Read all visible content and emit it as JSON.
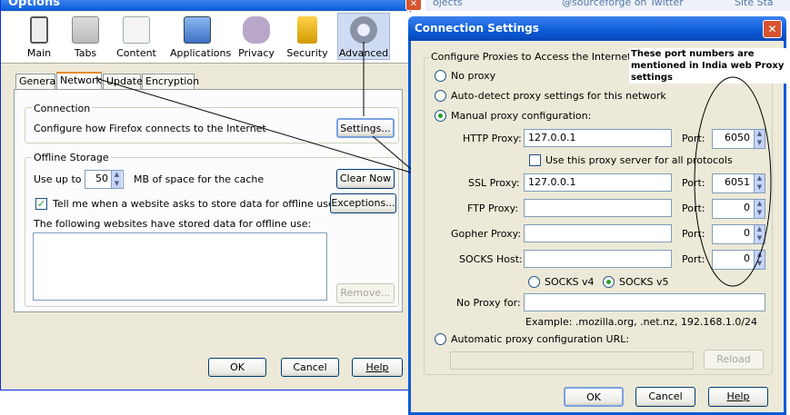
{
  "options": {
    "title": "Options",
    "toolbar": [
      {
        "label": "Main",
        "icon": "main-icon"
      },
      {
        "label": "Tabs",
        "icon": "tabs-icon"
      },
      {
        "label": "Content",
        "icon": "content-icon"
      },
      {
        "label": "Applications",
        "icon": "applications-icon"
      },
      {
        "label": "Privacy",
        "icon": "privacy-mask-icon"
      },
      {
        "label": "Security",
        "icon": "security-lock-icon"
      },
      {
        "label": "Advanced",
        "icon": "advanced-gear-icon"
      }
    ],
    "tabs": [
      "General",
      "Network",
      "Update",
      "Encryption"
    ],
    "connection": {
      "title": "Connection",
      "desc": "Configure how Firefox connects to the Internet",
      "settings_btn": "Settings..."
    },
    "offline": {
      "title": "Offline Storage",
      "use_up_to": "Use up to",
      "cache_value": "50",
      "cache_suffix": "MB of space for the cache",
      "clear_btn": "Clear Now",
      "tell_me": "Tell me when a website asks to store data for offline use",
      "exceptions_btn": "Exceptions...",
      "list_label": "The following websites have stored data for offline use:",
      "remove_btn": "Remove..."
    },
    "ok": "OK",
    "cancel": "Cancel",
    "help": "Help"
  },
  "browser_tabs": [
    "ojects",
    "@sourceforge on Twitter",
    "Site Sta"
  ],
  "conn": {
    "title": "Connection Settings",
    "group_title": "Configure Proxies to Access the Internet",
    "annotation": "These port numbers are mentioned in India web Proxy settings",
    "no_proxy": "No proxy",
    "auto_detect": "Auto-detect proxy settings for this network",
    "manual": "Manual proxy configuration:",
    "http_label": "HTTP Proxy:",
    "http_value": "127.0.0.1",
    "port_label": "Port:",
    "http_port": "6050",
    "same_proxy": "Use this proxy server for all protocols",
    "ssl_label": "SSL Proxy:",
    "ssl_value": "127.0.0.1",
    "ssl_port": "6051",
    "ftp_label": "FTP Proxy:",
    "ftp_port": "0",
    "gopher_label": "Gopher Proxy:",
    "gopher_port": "0",
    "socks_label": "SOCKS Host:",
    "socks_port": "0",
    "socks4": "SOCKS v4",
    "socks5": "SOCKS v5",
    "no_proxy_for": "No Proxy for:",
    "example": "Example: .mozilla.org, .net.nz, 192.168.1.0/24",
    "auto_url": "Automatic proxy configuration URL:",
    "reload": "Reload",
    "ok": "OK",
    "cancel": "Cancel",
    "help": "Help"
  },
  "colors": {
    "title_bar": "#0a5bd5",
    "dialog_bg": "#ece9d8",
    "close_red": "#d7542f"
  }
}
